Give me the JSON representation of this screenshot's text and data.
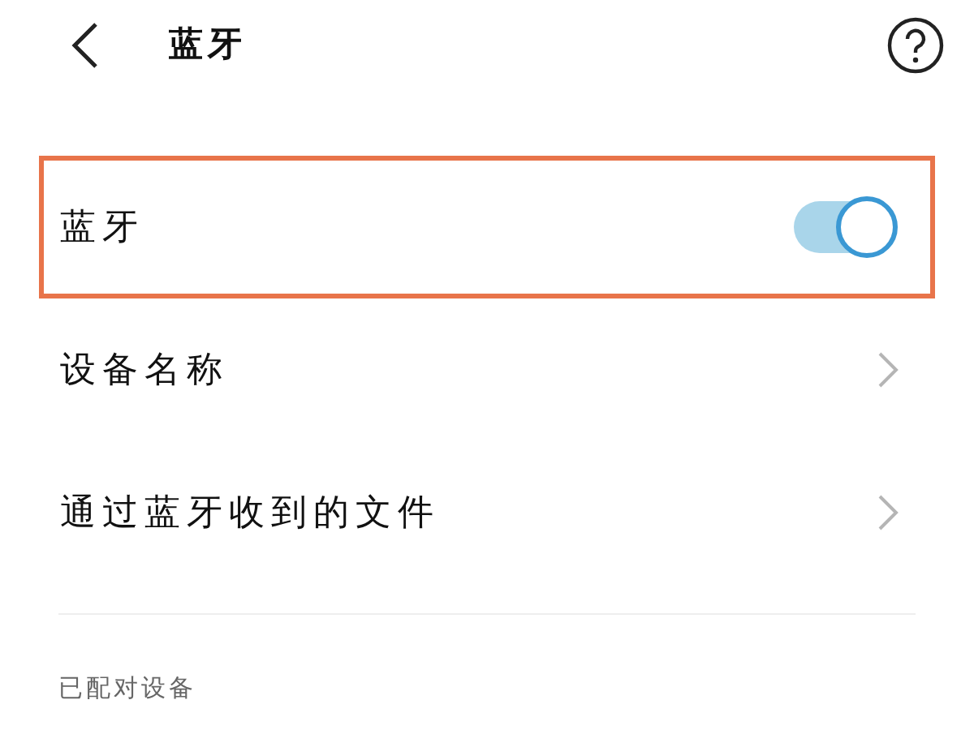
{
  "header": {
    "title": "蓝牙"
  },
  "settings": [
    {
      "kind": "toggle",
      "label": "蓝牙",
      "on": true,
      "highlighted": true
    },
    {
      "kind": "link",
      "label": "设备名称",
      "highlighted": false
    },
    {
      "kind": "link",
      "label": "通过蓝牙收到的文件",
      "highlighted": false
    }
  ],
  "section": {
    "title": "已配对设备"
  }
}
